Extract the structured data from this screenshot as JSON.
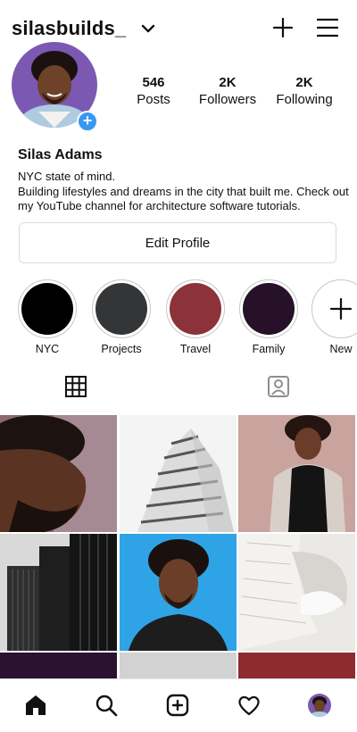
{
  "header": {
    "username": "silasbuilds_",
    "icons": {
      "account_switch": "chevron-down-icon",
      "create": "plus-icon",
      "menu": "hamburger-menu-icon"
    }
  },
  "profile": {
    "full_name": "Silas Adams",
    "bio_lines": [
      "NYC state of mind.",
      "Building lifestyles and dreams in the city that built me. Check out",
      "my YouTube channel for architecture software tutorials."
    ],
    "stats": [
      {
        "value": "546",
        "label": "Posts"
      },
      {
        "value": "2K",
        "label": "Followers"
      },
      {
        "value": "2K",
        "label": "Following"
      }
    ],
    "edit_button": "Edit Profile"
  },
  "highlights": [
    {
      "label": "NYC",
      "color": "#000000"
    },
    {
      "label": "Projects",
      "color": "#343537"
    },
    {
      "label": "Travel",
      "color": "#8b3338"
    },
    {
      "label": "Family",
      "color": "#261128"
    },
    {
      "label": "New",
      "color": "#ffffff"
    }
  ],
  "tabs": {
    "grid": "grid-icon",
    "tagged": "tagged-person-icon"
  },
  "posts": [
    "portrait-profile",
    "white-building",
    "woman-in-coat",
    "dark-skyscrapers",
    "man-blue-background",
    "white-curved-architecture",
    "post-7",
    "post-8",
    "post-9"
  ],
  "bottom_nav": [
    "home-icon",
    "search-icon",
    "new-post-icon",
    "heart-icon",
    "profile-avatar"
  ]
}
